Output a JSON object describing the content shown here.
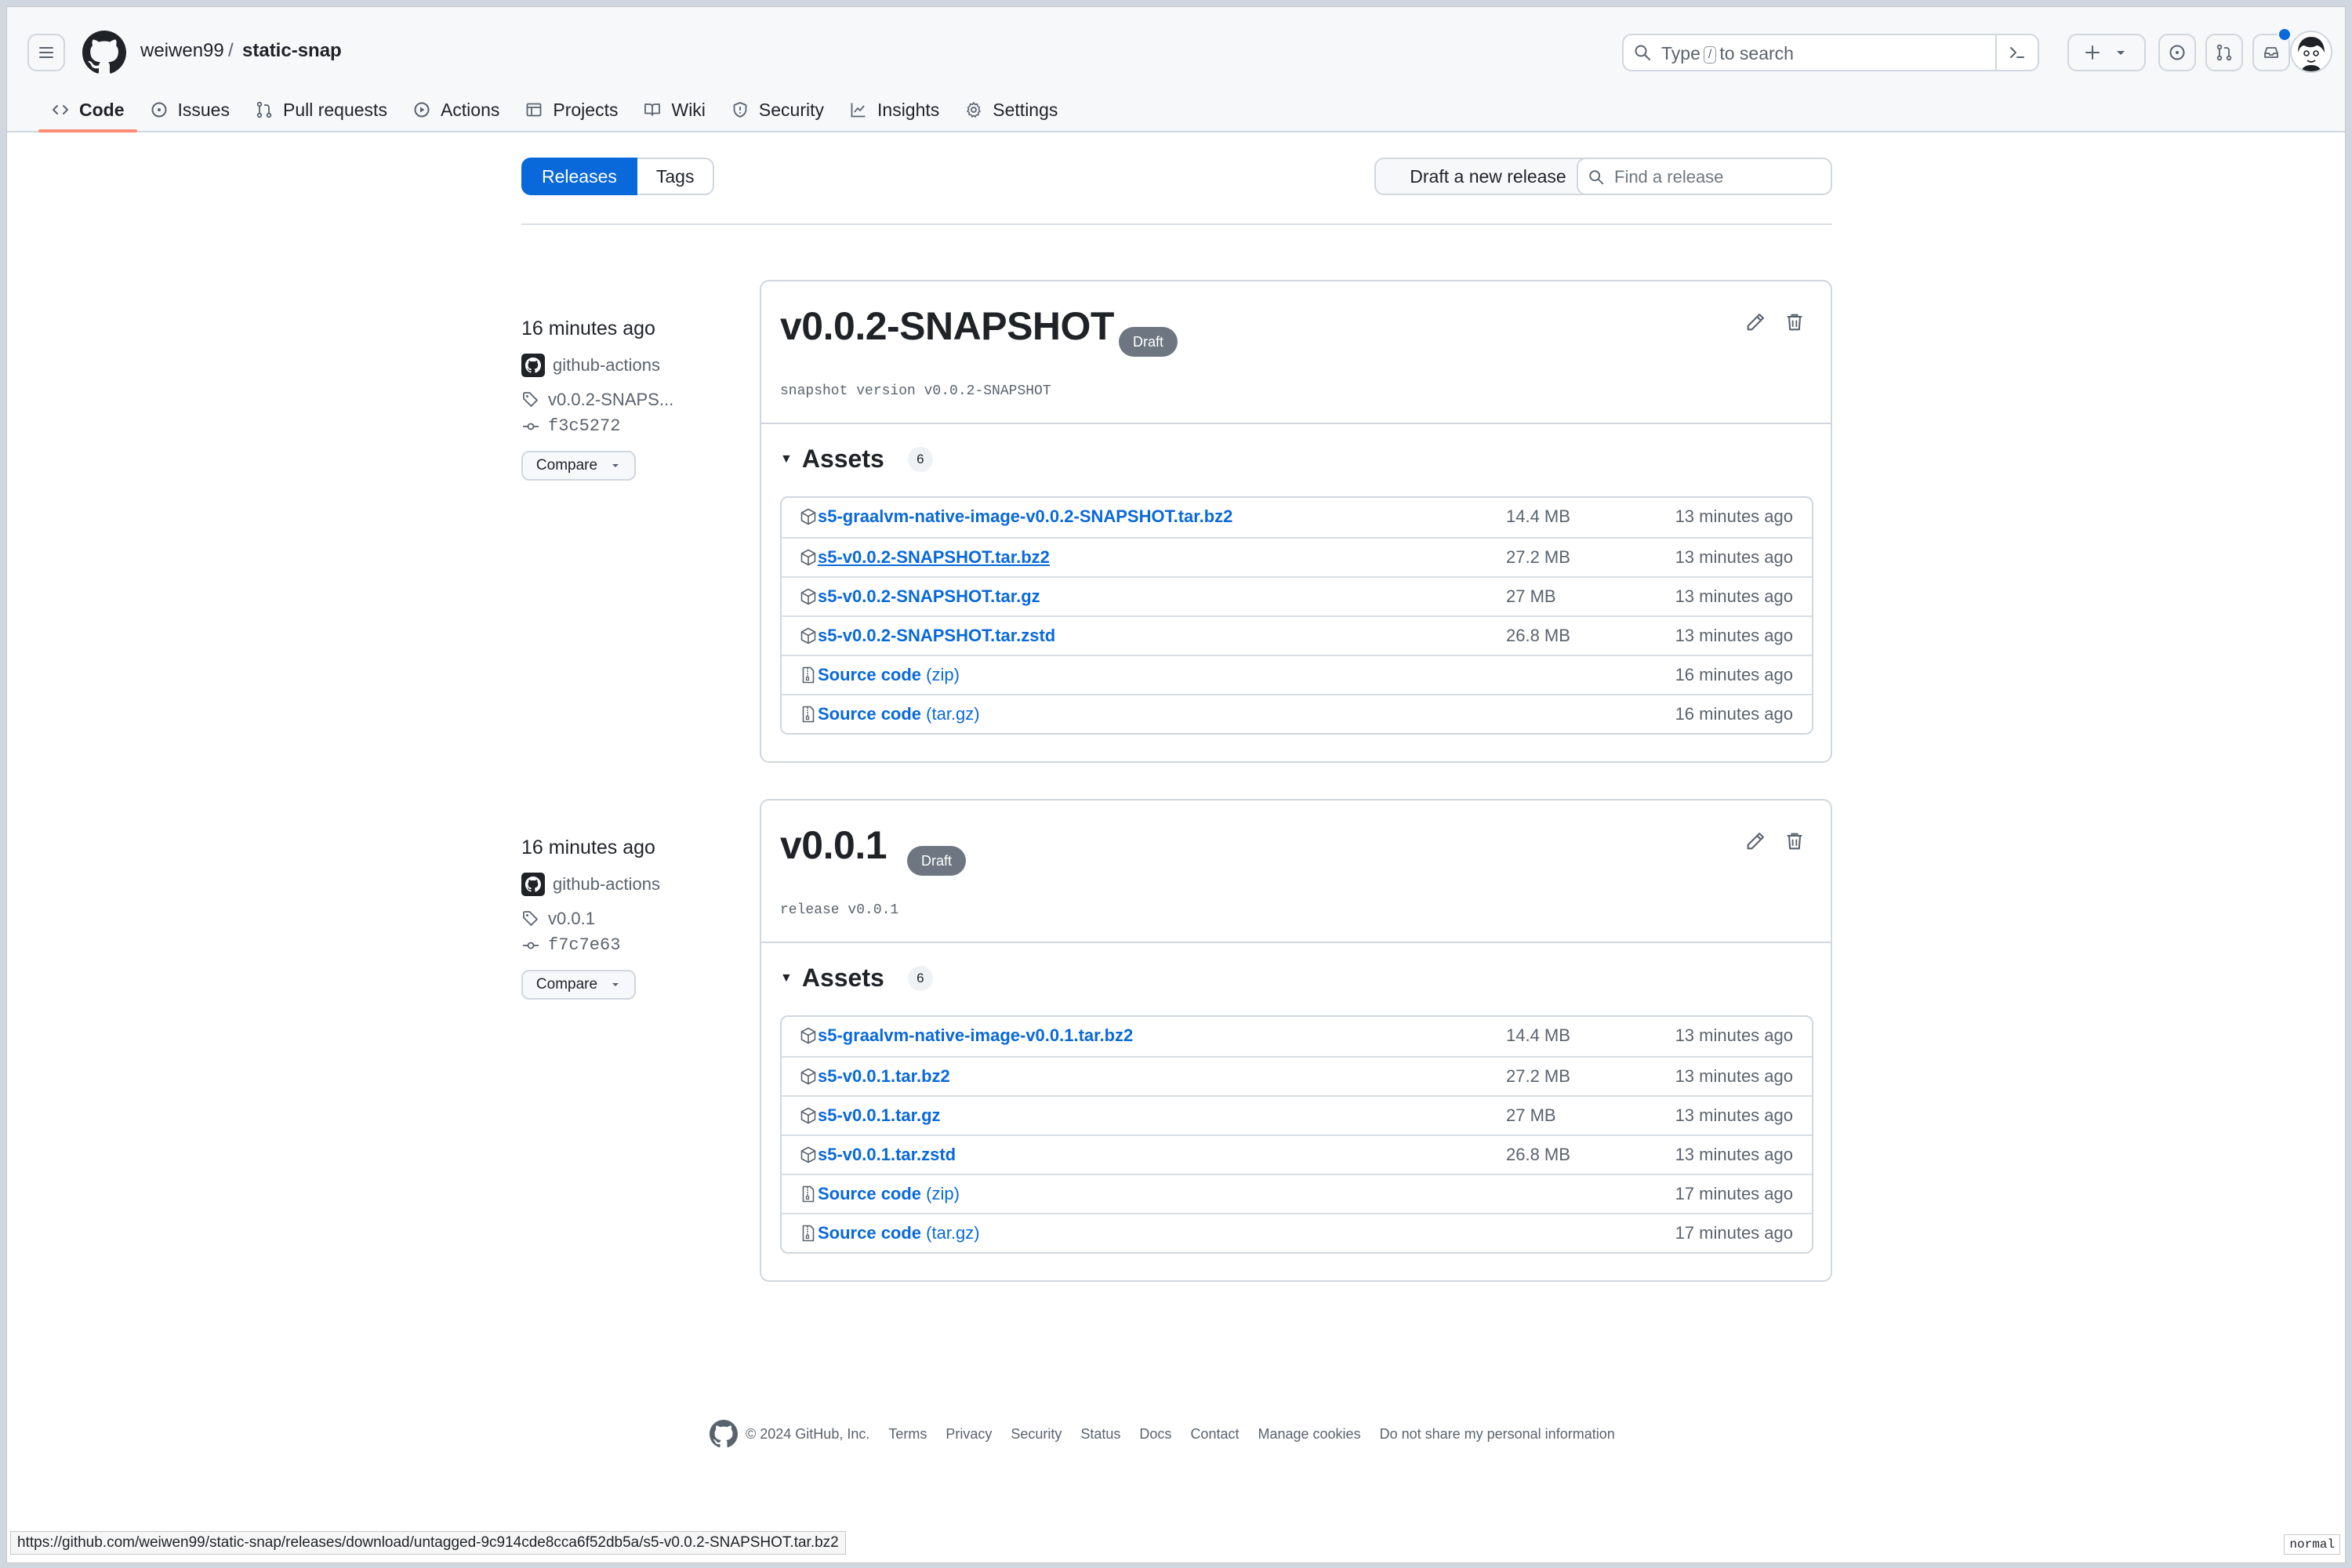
{
  "header": {
    "owner": "weiwen99",
    "separator": "/",
    "repo": "static-snap",
    "search_prefix": "Type",
    "search_key": "/",
    "search_suffix": "to search"
  },
  "repo_nav": [
    {
      "label": "Code",
      "icon": "code-icon",
      "active": true
    },
    {
      "label": "Issues",
      "icon": "issue-icon"
    },
    {
      "label": "Pull requests",
      "icon": "pull-request-icon"
    },
    {
      "label": "Actions",
      "icon": "play-icon"
    },
    {
      "label": "Projects",
      "icon": "table-icon"
    },
    {
      "label": "Wiki",
      "icon": "book-icon"
    },
    {
      "label": "Security",
      "icon": "shield-icon"
    },
    {
      "label": "Insights",
      "icon": "graph-icon"
    },
    {
      "label": "Settings",
      "icon": "gear-icon"
    }
  ],
  "subnav": {
    "releases_label": "Releases",
    "tags_label": "Tags",
    "draft_button": "Draft a new release",
    "find_placeholder": "Find a release"
  },
  "releases": [
    {
      "time": "16 minutes ago",
      "author": "github-actions",
      "tag": "v0.0.2-SNAPS...",
      "commit": "f3c5272",
      "compare": "Compare",
      "title": "v0.0.2-SNAPSHOT",
      "badge": "Draft",
      "description": "snapshot version v0.0.2-SNAPSHOT",
      "assets_label": "Assets",
      "assets_count": "6",
      "assets": [
        {
          "name": "s5-graalvm-native-image-v0.0.2-SNAPSHOT.tar.bz2",
          "suffix": "",
          "size": "14.4 MB",
          "when": "13 minutes ago",
          "icon": "package-icon"
        },
        {
          "name": "s5-v0.0.2-SNAPSHOT.tar.bz2",
          "suffix": "",
          "size": "27.2 MB",
          "when": "13 minutes ago",
          "icon": "package-icon",
          "hover": true
        },
        {
          "name": "s5-v0.0.2-SNAPSHOT.tar.gz",
          "suffix": "",
          "size": "27 MB",
          "when": "13 minutes ago",
          "icon": "package-icon"
        },
        {
          "name": "s5-v0.0.2-SNAPSHOT.tar.zstd",
          "suffix": "",
          "size": "26.8 MB",
          "when": "13 minutes ago",
          "icon": "package-icon"
        },
        {
          "name": "Source code",
          "suffix": " (zip)",
          "size": "",
          "when": "16 minutes ago",
          "icon": "file-zip-icon"
        },
        {
          "name": "Source code",
          "suffix": " (tar.gz)",
          "size": "",
          "when": "16 minutes ago",
          "icon": "file-zip-icon"
        }
      ]
    },
    {
      "time": "16 minutes ago",
      "author": "github-actions",
      "tag": "v0.0.1",
      "commit": "f7c7e63",
      "compare": "Compare",
      "title": "v0.0.1",
      "badge": "Draft",
      "description": "release v0.0.1",
      "assets_label": "Assets",
      "assets_count": "6",
      "assets": [
        {
          "name": "s5-graalvm-native-image-v0.0.1.tar.bz2",
          "suffix": "",
          "size": "14.4 MB",
          "when": "13 minutes ago",
          "icon": "package-icon"
        },
        {
          "name": "s5-v0.0.1.tar.bz2",
          "suffix": "",
          "size": "27.2 MB",
          "when": "13 minutes ago",
          "icon": "package-icon"
        },
        {
          "name": "s5-v0.0.1.tar.gz",
          "suffix": "",
          "size": "27 MB",
          "when": "13 minutes ago",
          "icon": "package-icon"
        },
        {
          "name": "s5-v0.0.1.tar.zstd",
          "suffix": "",
          "size": "26.8 MB",
          "when": "13 minutes ago",
          "icon": "package-icon"
        },
        {
          "name": "Source code",
          "suffix": " (zip)",
          "size": "",
          "when": "17 minutes ago",
          "icon": "file-zip-icon"
        },
        {
          "name": "Source code",
          "suffix": " (tar.gz)",
          "size": "",
          "when": "17 minutes ago",
          "icon": "file-zip-icon"
        }
      ]
    }
  ],
  "footer": {
    "copyright": "© 2024 GitHub, Inc.",
    "links": [
      "Terms",
      "Privacy",
      "Security",
      "Status",
      "Docs",
      "Contact",
      "Manage cookies",
      "Do not share my personal information"
    ]
  },
  "status_url": "https://github.com/weiwen99/static-snap/releases/download/untagged-9c914cde8cca6f52db5a/s5-v0.0.2-SNAPSHOT.tar.bz2",
  "mode_indicator": "normal",
  "colors": {
    "accent": "#0969da",
    "nav_underline": "#fd8c73",
    "badge": "#6e7781"
  }
}
